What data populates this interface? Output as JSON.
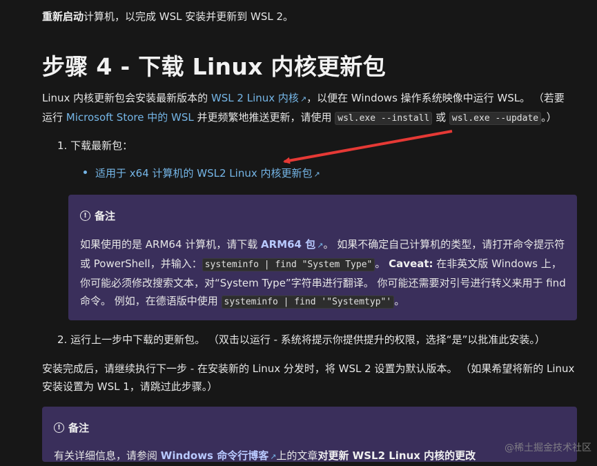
{
  "top_paragraph": {
    "bold": "重新启动",
    "rest": "计算机，以完成 WSL 安装并更新到 WSL 2。"
  },
  "heading": "步骤 4 - 下载 Linux 内核更新包",
  "intro": {
    "t1": "Linux 内核更新包会安装最新版本的 ",
    "link1": "WSL 2 Linux 内核",
    "t2": "，以便在 Windows 操作系统映像中运行 WSL。 （若要运行 ",
    "link2": "Microsoft Store 中的 WSL",
    "t3": " 并更频繁地推送更新，请使用 ",
    "code1": "wsl.exe --install",
    "t4": " 或 ",
    "code2": "wsl.exe --update",
    "t5": "。）"
  },
  "step1": "1. 下载最新包：",
  "download_link": "适用于 x64 计算机的 WSL2 Linux 内核更新包",
  "note1": {
    "title": "备注",
    "t1": "如果使用的是 ARM64 计算机，请下载 ",
    "link": "ARM64 包",
    "t2": "。 如果不确定自己计算机的类型，请打开命令提示符或 PowerShell，并输入：",
    "code1": "systeminfo | find \"System Type\"",
    "t3": "。",
    "caveat": "Caveat:",
    "t4": " 在非英文版 Windows 上，你可能必须修改搜索文本，对“System Type”字符串进行翻译。 你可能还需要对引号进行转义来用于 find 命令。 例如，在德语版中使用 ",
    "code2": "systeminfo | find '\"Systemtyp\"'",
    "t5": "。"
  },
  "step2": "2. 运行上一步中下载的更新包。 （双击以运行 - 系统将提示你提供提升的权限，选择“是”以批准此安装。）",
  "after": "安装完成后，请继续执行下一步 - 在安装新的 Linux 分发时，将 WSL 2 设置为默认版本。 （如果希望将新的 Linux 安装设置为 WSL 1，请跳过此步骤。）",
  "note2": {
    "title": "备注",
    "t1": "有关详细信息，请参阅 ",
    "link": "Windows 命令行博客",
    "t2": "上的文章",
    "bold": "对更新 WSL2 Linux 内核的更改"
  },
  "watermark": "@稀土掘金技术社区",
  "colors": {
    "link": "#75b6e7",
    "note_bg": "#3a2f5b",
    "arrow": "#e53935",
    "bg": "#171717"
  }
}
